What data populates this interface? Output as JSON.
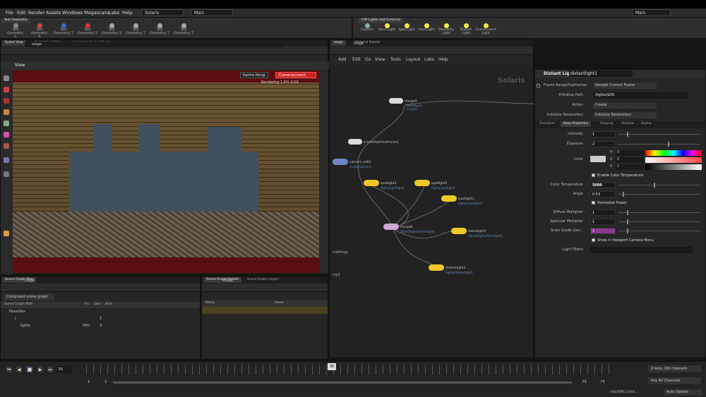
{
  "menu": {
    "items": [
      "File",
      "Edit",
      "Render",
      "Assets",
      "Windows",
      "Megascans",
      "Labs",
      "Help"
    ],
    "desktop": "Solaris",
    "layout": "Main",
    "right_desktop": "Main"
  },
  "shelf_left": {
    "tab": "Test Geometry",
    "tools": [
      "Test Geometry: C",
      "Test Geometry: R",
      "Test Geometry: T",
      "Test Geometry: S",
      "Test Geometry: S",
      "Test Geometry: T",
      "Test Geometry: T",
      "Test Geometry: T"
    ]
  },
  "shelf_right": {
    "tab": "LOP Lights and Cameras",
    "tools": [
      "Camera",
      "Point Light",
      "Spot Light",
      "Area Light",
      "Geometry Light",
      "Distant Light",
      "Environment Light"
    ]
  },
  "scene_view": {
    "tabs": [
      "Scene View",
      "Animation Editor",
      "Geometry Spreadsheet"
    ],
    "path": "stage",
    "view_label": "View",
    "renderer": "Karma Persp",
    "camera": "/Cameras/cam1",
    "render_status": "Rendering",
    "progress": "1.6%",
    "time": "0:06"
  },
  "network": {
    "tabs": [
      "stage",
      "Material Palette"
    ],
    "path": "stage",
    "menu": [
      "Add",
      "Edit",
      "Go",
      "View",
      "Tools",
      "Layout",
      "Labs",
      "Help"
    ],
    "watermark": "Solaris",
    "nodes": [
      {
        "name": "merge4",
        "sub": "/World/geo/...",
        "info": "3 Layers"
      },
      {
        "name": "sceneimportcameras1",
        "sub": ""
      },
      {
        "name": "camera_edit1",
        "sub": "/Cameras/cam1"
      },
      {
        "name": "spotlight1",
        "sub": "/lights/spotlight1"
      },
      {
        "name": "spotlight2",
        "sub": "/lights/spotlight2"
      },
      {
        "name": "spotlight3",
        "sub": "/lights/spotlight3"
      },
      {
        "name": "merge6",
        "sub": "/World/lights/domelight1"
      },
      {
        "name": "domelight1",
        "sub": "/World/lights/domelight1"
      },
      {
        "name": "distantlight1",
        "sub": "/lights/distantlight1"
      }
    ],
    "left_labels": [
      "rsettings",
      "rop1"
    ]
  },
  "params": {
    "type": "Distant Light",
    "name": "distantlight1",
    "frame_range": "Frame Range/Subframes",
    "frame_range_val": "Sample Current Frame",
    "primitive_path_label": "Primitive Path",
    "primitive_path": "/lights/$OS",
    "action_label": "Action",
    "action": "Create",
    "init_label": "Initialize Parameters",
    "init_val": "Initialize Parameters",
    "tabs": [
      "Transform",
      "Base Properties",
      "Shaping",
      "Shadow",
      "Karma"
    ],
    "intensity_label": "Intensity",
    "intensity": "1",
    "exposure_label": "Exposure",
    "exposure": "2",
    "color_label": "Color",
    "h": "H",
    "s": "S",
    "v": "V",
    "h_val": "0",
    "s_val": "0",
    "v_val": "1",
    "enable_temp": "Enable Color Temperature",
    "temp_label": "Color Temperature",
    "temp": "5000",
    "angle_label": "Angle",
    "angle": "0.53",
    "normalize": "Normalize Power",
    "diffuse_label": "Diffuse Multiplier",
    "diffuse": "1",
    "specular_label": "Specular Multiplier",
    "specular": "1",
    "guide_label": "Scale Guide Geo...",
    "guide": "1",
    "show_viewport": "Show in Viewport Camera Menu",
    "filters_label": "Light Filters"
  },
  "scene_graph": {
    "tabs": [
      "Scene Graph Tree"
    ],
    "path": "stage",
    "dropdown": "Composed scene graph",
    "cols": [
      "Scene Graph Path",
      "Pri",
      "Des",
      "Kind"
    ],
    "rows": [
      {
        "name": "Favorites",
        "pri": "",
        "des": ""
      },
      {
        "name": "/",
        "pri": "",
        "des": "2"
      },
      {
        "name": "lights",
        "pri": "Xfm",
        "des": "3"
      }
    ]
  },
  "details": {
    "tabs": [
      "Scene Graph Details",
      "Scene Graph Layers"
    ],
    "path": "stage",
    "cols": [
      "Name",
      "Value"
    ]
  },
  "timeline": {
    "frame": "36",
    "start": "1",
    "range_start": "1",
    "end": "75",
    "range_end": "75",
    "marker": "36",
    "keys": "0 keys, 0/0 channels",
    "key_all": "Key All Channels",
    "obj_path": "/obj/WALL/rbd...",
    "auto_update": "Auto Update"
  },
  "colors": {
    "accent_yellow": "#f0c82a",
    "selected_blue": "#6f86c8",
    "viewport_red": "#5a0f12",
    "guide_purple": "#8a3a8f"
  }
}
